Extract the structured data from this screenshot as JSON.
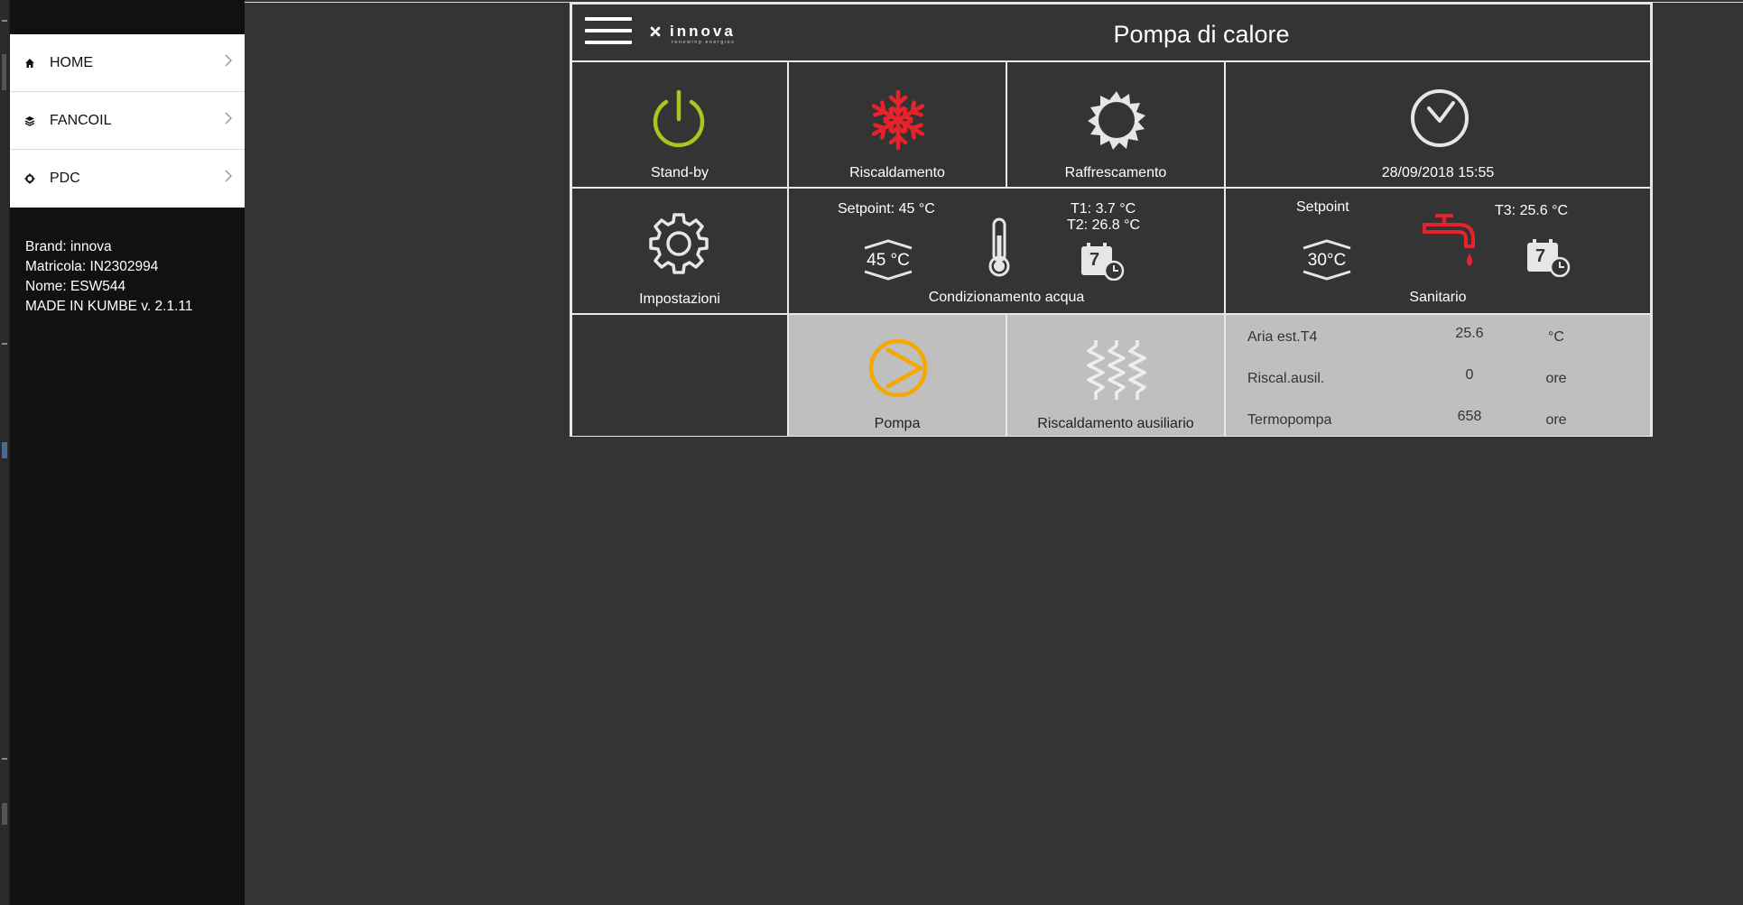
{
  "sidebar": {
    "items": [
      {
        "label": "HOME",
        "icon": "home-icon"
      },
      {
        "label": "FANCOIL",
        "icon": "layers-icon"
      },
      {
        "label": "PDC",
        "icon": "gear-icon"
      }
    ],
    "info": {
      "brand": "Brand: innova",
      "matricola": "Matricola: IN2302994",
      "nome": "Nome: ESW544",
      "made": "MADE IN KUMBE v. 2.1.11"
    }
  },
  "header": {
    "logo_text": "innova",
    "logo_sub": "renewing energies",
    "title": "Pompa di calore"
  },
  "tiles": {
    "standby": {
      "label": "Stand-by",
      "icon": "power-icon",
      "color": "#a6c81e"
    },
    "riscaldamento": {
      "label": "Riscaldamento",
      "icon": "snowflake-icon",
      "color": "#e8222a"
    },
    "raffrescamento": {
      "label": "Raffrescamento",
      "icon": "sun-icon"
    },
    "clock": {
      "label": "28/09/2018 15:55",
      "icon": "clock-icon"
    },
    "impostazioni": {
      "label": "Impostazioni",
      "icon": "settings-gear-icon"
    },
    "condizionamento": {
      "label": "Condizionamento acqua",
      "setpoint": "Setpoint: 45 °C",
      "setpoint_value": "45 °C",
      "t1": "T1: 3.7 °C",
      "t2": "T2: 26.8 °C",
      "calendar_day": "7"
    },
    "sanitario": {
      "label": "Sanitario",
      "setpoint": "Setpoint",
      "setpoint_value": "30°C",
      "t3": "T3: 25.6 °C",
      "calendar_day": "7",
      "tap_color": "#e8222a"
    },
    "pompa": {
      "label": "Pompa",
      "icon": "pump-icon",
      "color": "#f5a800"
    },
    "ausiliario": {
      "label": "Riscaldamento ausiliario",
      "icon": "heater-icon"
    }
  },
  "stats": [
    {
      "key": "Aria est.T4",
      "value": "25.6",
      "unit": "°C"
    },
    {
      "key": "Riscal.ausil.",
      "value": "0",
      "unit": "ore"
    },
    {
      "key": "Termopompa",
      "value": "658",
      "unit": "ore"
    }
  ]
}
